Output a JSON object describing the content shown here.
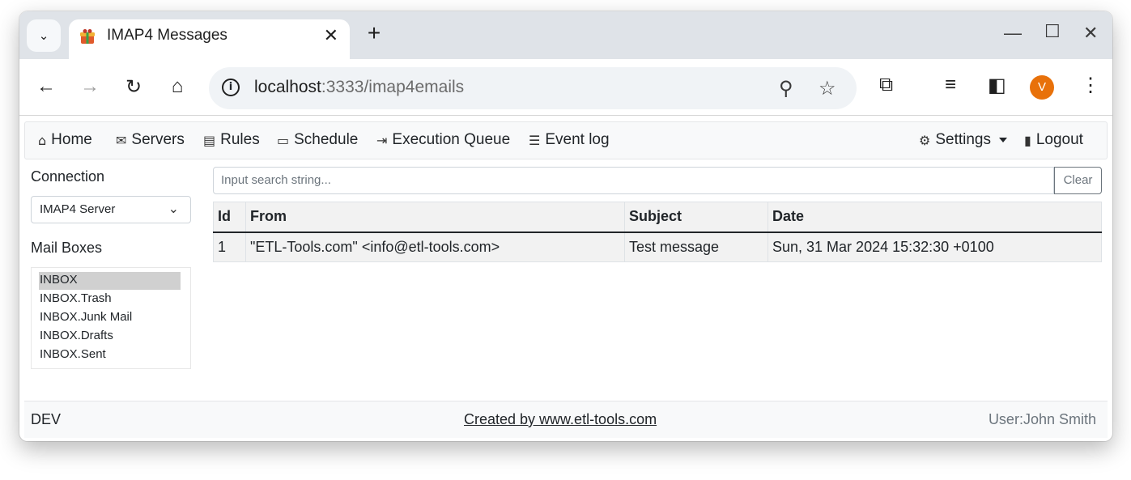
{
  "browser": {
    "tab_title": "IMAP4 Messages",
    "url_host": "localhost",
    "url_path": ":3333/imap4emails",
    "profile_initial": "V",
    "profile_color": "#e8710a"
  },
  "nav": {
    "items": [
      {
        "label": "Home",
        "icon": "house-icon"
      },
      {
        "label": "Servers",
        "icon": "envelope-icon"
      },
      {
        "label": "Rules",
        "icon": "card-list-icon"
      },
      {
        "label": "Schedule",
        "icon": "calendar-icon"
      },
      {
        "label": "Execution Queue",
        "icon": "box-arrow-in-icon"
      },
      {
        "label": "Event log",
        "icon": "list-check-icon"
      }
    ],
    "settings_label": "Settings",
    "logout_label": "Logout"
  },
  "sidebar": {
    "connection_label": "Connection",
    "connection_value": "IMAP4 Server",
    "mailboxes_label": "Mail Boxes",
    "mailboxes": [
      "INBOX",
      "INBOX.Trash",
      "INBOX.Junk Mail",
      "INBOX.Drafts",
      "INBOX.Sent"
    ],
    "selected": "INBOX"
  },
  "search": {
    "placeholder": "Input search string...",
    "clear_label": "Clear"
  },
  "table": {
    "headers": [
      "Id",
      "From",
      "Subject",
      "Date"
    ],
    "rows": [
      [
        "1",
        "\"ETL-Tools.com\" <info@etl-tools.com>",
        "Test message",
        "Sun, 31 Mar 2024 15:32:30 +0100"
      ]
    ]
  },
  "footer": {
    "env": "DEV",
    "credit": "Created by www.etl-tools.com",
    "user": "User:John Smith"
  }
}
